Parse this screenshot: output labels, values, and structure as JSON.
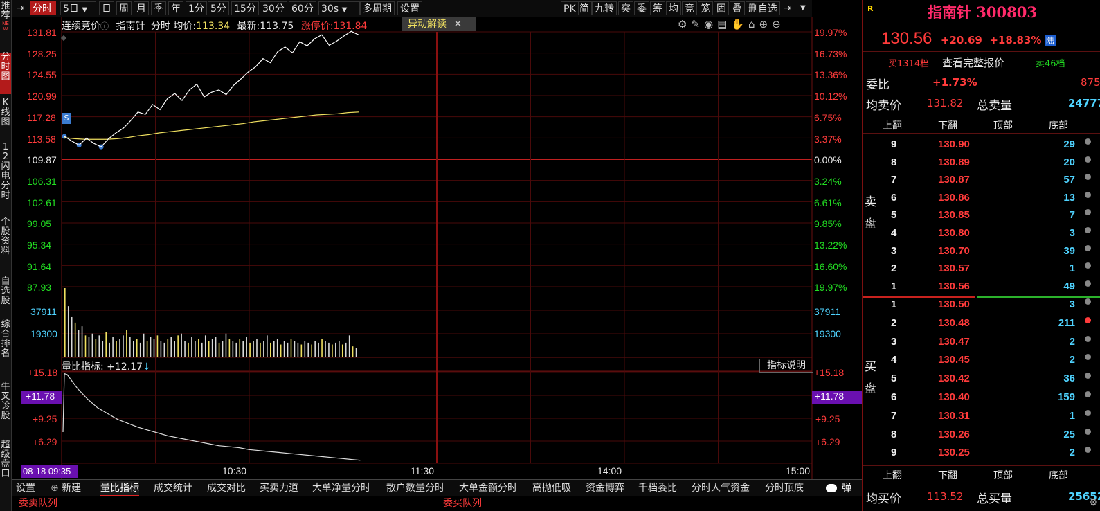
{
  "vtabs": [
    "推荐",
    "分时图",
    "K线图",
    "12闪电分时",
    "个股资料",
    "自选股",
    "综合排名",
    "牛叉诊股",
    "超级盘口"
  ],
  "vtab_new_badge": "NEW",
  "toolbar": {
    "left": [
      "分时",
      "5日",
      "日",
      "周",
      "月",
      "季",
      "年",
      "1分",
      "5分",
      "15分",
      "30分",
      "60分",
      "30s",
      "多周期",
      "设置"
    ],
    "right": [
      "PK",
      "简",
      "九转",
      "突",
      "委",
      "筹",
      "均",
      "竞",
      "笼",
      "固",
      "叠",
      "删自选"
    ]
  },
  "chart_header": {
    "mode": "连续竞价",
    "stock": "指南针",
    "type": "分时",
    "avg_label": "均价:",
    "avg_value": "113.34",
    "last_label": "最新:",
    "last_value": "113.75",
    "limit_label": "涨停价:",
    "limit_value": "131.84",
    "anomaly_button": "异动解读",
    "s_marker": "S"
  },
  "price_axis_left": [
    "131.81",
    "128.25",
    "124.55",
    "120.99",
    "117.28",
    "113.58",
    "109.87",
    "106.31",
    "102.61",
    "99.05",
    "95.34",
    "91.64",
    "87.93"
  ],
  "pct_axis_right": [
    "19.97%",
    "16.73%",
    "13.36%",
    "10.12%",
    "6.75%",
    "3.37%",
    "0.00%",
    "3.24%",
    "6.61%",
    "9.85%",
    "13.22%",
    "16.60%",
    "19.97%"
  ],
  "volume_axis": [
    "37911",
    "19300"
  ],
  "ratio_panel": {
    "label": "量比指标:",
    "value": "+12.17",
    "arrow": "↓",
    "explain_button": "指标说明",
    "left_ticks": [
      "+15.18",
      "+11.78",
      "+9.25",
      "+6.29"
    ],
    "right_ticks": [
      "+15.18",
      "+11.78",
      "+9.25",
      "+6.29"
    ]
  },
  "time_axis": {
    "cursor": "08-18 09:35",
    "labels": [
      "10:30",
      "11:30",
      "14:00",
      "15:00"
    ]
  },
  "chart_data": {
    "type": "line",
    "x_range": [
      "09:30",
      "15:00"
    ],
    "series": [
      {
        "name": "price",
        "color": "#ffffff",
        "values": [
          113.8,
          113.0,
          112.3,
          113.5,
          112.6,
          112.0,
          113.4,
          114.4,
          115.2,
          116.5,
          118.0,
          117.6,
          119.3,
          118.4,
          120.3,
          121.2,
          120.0,
          121.8,
          122.8,
          120.6,
          121.4,
          121.8,
          121.0,
          122.6,
          123.7,
          124.9,
          125.8,
          127.2,
          126.5,
          128.4,
          129.2,
          128.2,
          130.1,
          129.4,
          130.6,
          131.3,
          129.5,
          130.2,
          131.1,
          131.9,
          131.3
        ]
      },
      {
        "name": "avg",
        "color": "#f0e060",
        "values": [
          113.6,
          113.4,
          113.3,
          113.3,
          113.3,
          113.4,
          113.6,
          113.9,
          114.1,
          114.4,
          114.6,
          114.8,
          115.0,
          115.2,
          115.4,
          115.6,
          115.8,
          116.0,
          116.3,
          116.5,
          116.7,
          116.9,
          117.1,
          117.3,
          117.5,
          117.6,
          117.7,
          117.9,
          118.0
        ]
      },
      {
        "name": "volume_ratio",
        "color": "#dddddd",
        "values": [
          14.9,
          13.5,
          12.4,
          11.5,
          10.9,
          10.3,
          9.9,
          9.5,
          9.2,
          8.9,
          8.6,
          8.4,
          8.2,
          8.0,
          7.8,
          7.6,
          7.5,
          7.4,
          7.2,
          7.1,
          7.0,
          6.9,
          6.8,
          6.7,
          6.6,
          6.5,
          6.4,
          6.3,
          6.2,
          6.1
        ]
      }
    ],
    "volume_bars": [
      37911,
      28000,
      22000,
      19000,
      15000,
      17000,
      12000,
      11000,
      13000,
      10000,
      12000,
      9000,
      14000,
      8000,
      11000,
      9000,
      10000,
      12000,
      15000,
      11000,
      9000,
      10000,
      8000,
      13000,
      9000,
      11000,
      10000,
      12000,
      9000,
      8000,
      10000,
      11000,
      9000,
      12000,
      13000,
      9000,
      8000,
      11000,
      9000,
      10000,
      8000,
      12000,
      9000,
      10000,
      11000,
      8000,
      9000,
      13000,
      10000,
      9000,
      8000,
      10000,
      9000,
      11000,
      8000,
      9000,
      10000,
      8000,
      9000,
      12000,
      8000,
      9000,
      10000,
      7000,
      9000,
      8000,
      10000,
      9000,
      8000,
      7000,
      9000,
      8000,
      7000,
      9000,
      8000,
      10000,
      9000,
      8000,
      7000,
      8000,
      9000,
      7000,
      8000,
      12000,
      6000,
      5000
    ],
    "ylim": [
      87.93,
      131.81
    ]
  },
  "bottom_tabs": [
    "设置",
    "新建",
    "量比指标",
    "成交统计",
    "成交对比",
    "买卖力道",
    "大单净量分时",
    "散户数量分时",
    "大单金额分时",
    "高抛低吸",
    "资金博弈",
    "千档委比",
    "分时人气资金",
    "分时顶底"
  ],
  "bottom_bar": {
    "left": "委卖队列",
    "mid": "委买队列",
    "toggle": "弹"
  },
  "right_panel": {
    "r_mark": "R",
    "title": "指南针 300803",
    "price": "130.56",
    "change": "+20.69",
    "pct": "+18.83%",
    "market": "陆",
    "btn_buy": "买1314档",
    "btn_full": "查看完整报价",
    "btn_sell": "卖46档",
    "weibi_label": "委比",
    "weibi_pct": "+1.73%",
    "weibi_val": "875",
    "avg_sell_label": "均卖价",
    "avg_sell_val": "131.82",
    "total_sell_label": "总卖量",
    "total_sell_val": "24777",
    "nav": [
      "上翻",
      "下翻",
      "顶部",
      "底部"
    ],
    "sell_side_label": "卖盘",
    "buy_side_label": "买盘",
    "asks": [
      {
        "lvl": "9",
        "price": "130.90",
        "vol": "29"
      },
      {
        "lvl": "8",
        "price": "130.89",
        "vol": "20"
      },
      {
        "lvl": "7",
        "price": "130.87",
        "vol": "57"
      },
      {
        "lvl": "6",
        "price": "130.86",
        "vol": "13"
      },
      {
        "lvl": "5",
        "price": "130.85",
        "vol": "7"
      },
      {
        "lvl": "4",
        "price": "130.80",
        "vol": "3"
      },
      {
        "lvl": "3",
        "price": "130.70",
        "vol": "39"
      },
      {
        "lvl": "2",
        "price": "130.57",
        "vol": "1"
      },
      {
        "lvl": "1",
        "price": "130.56",
        "vol": "49"
      }
    ],
    "bids": [
      {
        "lvl": "1",
        "price": "130.50",
        "vol": "3"
      },
      {
        "lvl": "2",
        "price": "130.48",
        "vol": "211"
      },
      {
        "lvl": "3",
        "price": "130.47",
        "vol": "2"
      },
      {
        "lvl": "4",
        "price": "130.45",
        "vol": "2"
      },
      {
        "lvl": "5",
        "price": "130.42",
        "vol": "36"
      },
      {
        "lvl": "6",
        "price": "130.40",
        "vol": "159"
      },
      {
        "lvl": "7",
        "price": "130.31",
        "vol": "1"
      },
      {
        "lvl": "8",
        "price": "130.26",
        "vol": "25"
      },
      {
        "lvl": "9",
        "price": "130.25",
        "vol": "2"
      }
    ],
    "avg_buy_label": "均买价",
    "avg_buy_val": "113.52",
    "total_buy_label": "总买量",
    "total_buy_val": "25652"
  }
}
